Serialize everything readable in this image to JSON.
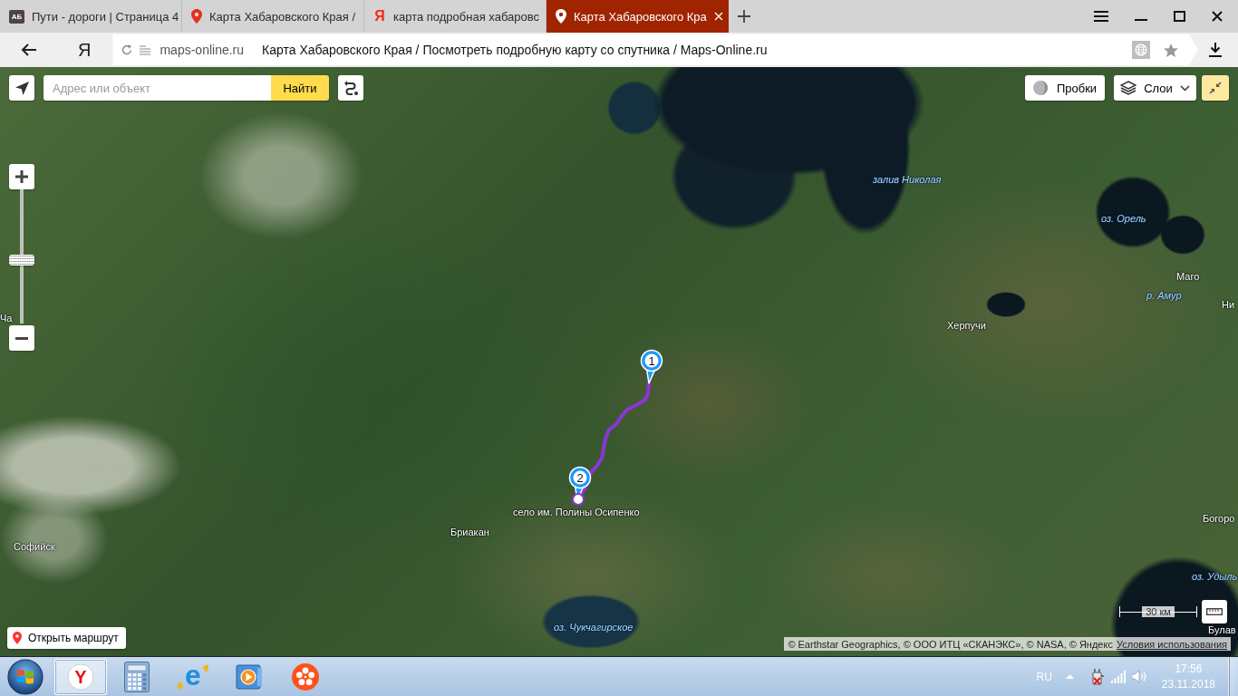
{
  "browser": {
    "tabs": [
      {
        "title": "Пути - дороги | Страница 4",
        "kind": "tile",
        "favicon_text": "АБ",
        "selected": false
      },
      {
        "title": "Карта Хабаровского Края /",
        "kind": "pin",
        "selected": false
      },
      {
        "title": "карта подробная хабаровс",
        "kind": "letter",
        "favicon_text": "Я",
        "selected": false
      },
      {
        "title": "Карта Хабаровского Кра",
        "kind": "pin",
        "selected": true
      }
    ],
    "home_button": "Я",
    "address": {
      "domain": "maps-online.ru",
      "page_title": "Карта Хабаровского Края / Посмотреть подробную карту со спутника / Maps-Online.ru"
    }
  },
  "map": {
    "search": {
      "placeholder": "Адрес или объект",
      "button": "Найти"
    },
    "traffic_button": "Пробки",
    "layers_button": "Слои",
    "zoom": {
      "level": 0.47
    },
    "labels": [
      {
        "text": "залив Николая",
        "kind": "water"
      },
      {
        "text": "оз. Орель",
        "kind": "water"
      },
      {
        "text": "Маго",
        "kind": "place"
      },
      {
        "text": "р. Амур",
        "kind": "water"
      },
      {
        "text": "Ни",
        "kind": "place"
      },
      {
        "text": "Херпучи",
        "kind": "place"
      },
      {
        "text": "Ча",
        "kind": "place"
      },
      {
        "text": "село им. Полины Осипенко",
        "kind": "place"
      },
      {
        "text": "Бриакан",
        "kind": "place"
      },
      {
        "text": "Софийск",
        "kind": "place"
      },
      {
        "text": "Богоро",
        "kind": "place"
      },
      {
        "text": "оз. Удыль",
        "kind": "water"
      },
      {
        "text": "оз. Чукчагирское",
        "kind": "water"
      },
      {
        "text": "Булав",
        "kind": "place"
      }
    ],
    "route": {
      "points": [
        {
          "label": "1"
        },
        {
          "label": "2"
        }
      ]
    },
    "open_route_button": "Открыть маршрут",
    "scale": "30 км",
    "attribution": {
      "text": "© Earthstar Geographics, © ООО ИТЦ «СКАНЭКС», © NASA, © Яндекс",
      "link": "Условия использования"
    }
  },
  "taskbar": {
    "apps": [
      {
        "kind": "browser",
        "glyph": "Y",
        "selected": true
      },
      {
        "kind": "calculator",
        "selected": false
      },
      {
        "kind": "ie",
        "glyph": "e",
        "selected": false
      },
      {
        "kind": "player",
        "selected": false
      },
      {
        "kind": "reel",
        "selected": false
      }
    ],
    "language": "RU",
    "time": "17:56",
    "date": "23.11.2018"
  }
}
